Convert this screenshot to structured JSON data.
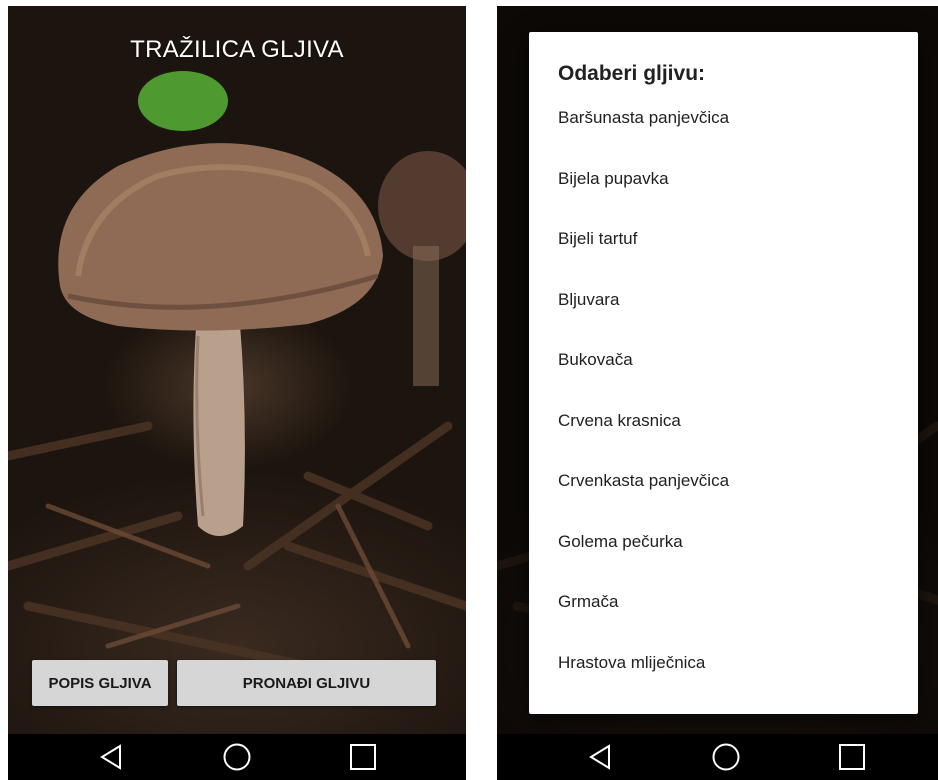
{
  "left_screen": {
    "title": "TRAŽILICA GLJIVA",
    "buttons": {
      "list_label": "POPIS GLJIVA",
      "find_label": "PRONAĐI GLJIVU"
    }
  },
  "right_screen": {
    "dialog": {
      "title": "Odaberi gljivu:",
      "items": [
        "Baršunasta panjevčica",
        "Bijela pupavka",
        "Bijeli tartuf",
        "Bljuvara",
        "Bukovača",
        "Crvena krasnica",
        "Crvenkasta panjevčica",
        "Golema pečurka",
        "Grmača",
        "Hrastova mliječnica"
      ]
    }
  },
  "navbar": {
    "icons": [
      "back-icon",
      "home-icon",
      "recents-icon"
    ]
  },
  "colors": {
    "button_bg": "#d6d6d6",
    "navbar_bg": "#000000",
    "dialog_bg": "#ffffff"
  }
}
